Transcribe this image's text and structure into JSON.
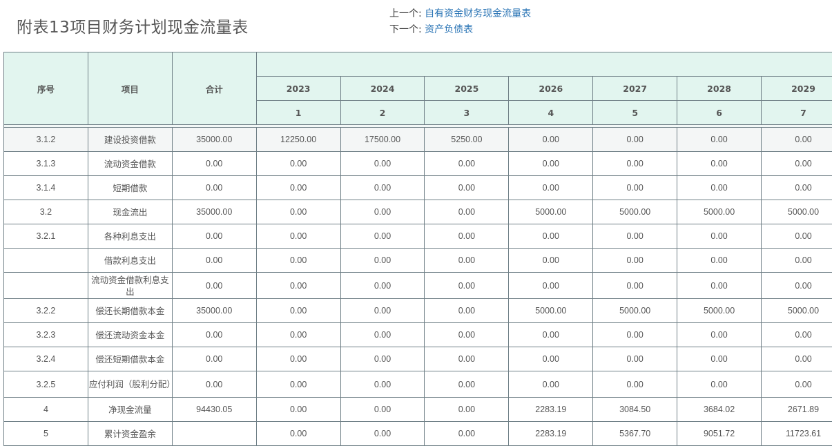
{
  "title": "附表13项目财务计划现金流量表",
  "nav": {
    "prev_label": "上一个:",
    "prev_link": "自有资金财务现金流量表",
    "next_label": "下一个:",
    "next_link": "资产负债表"
  },
  "table": {
    "headers": {
      "seq": "序号",
      "item": "项目",
      "total": "合计"
    },
    "years": [
      "2023",
      "2024",
      "2025",
      "2026",
      "2027",
      "2028",
      "2029"
    ],
    "indices": [
      "1",
      "2",
      "3",
      "4",
      "5",
      "6",
      "7"
    ],
    "rows": [
      {
        "seq": "3.1.2",
        "name": "建设投资借款",
        "total": "35000.00",
        "vals": [
          "12250.00",
          "17500.00",
          "5250.00",
          "0.00",
          "0.00",
          "0.00",
          "0.00"
        ]
      },
      {
        "seq": "3.1.3",
        "name": "流动资金借款",
        "total": "0.00",
        "vals": [
          "0.00",
          "0.00",
          "0.00",
          "0.00",
          "0.00",
          "0.00",
          "0.00"
        ]
      },
      {
        "seq": "3.1.4",
        "name": "短期借款",
        "total": "0.00",
        "vals": [
          "0.00",
          "0.00",
          "0.00",
          "0.00",
          "0.00",
          "0.00",
          "0.00"
        ]
      },
      {
        "seq": "3.2",
        "name": "现金流出",
        "total": "35000.00",
        "vals": [
          "0.00",
          "0.00",
          "0.00",
          "5000.00",
          "5000.00",
          "5000.00",
          "5000.00"
        ]
      },
      {
        "seq": "3.2.1",
        "name": "各种利息支出",
        "total": "0.00",
        "vals": [
          "0.00",
          "0.00",
          "0.00",
          "0.00",
          "0.00",
          "0.00",
          "0.00"
        ]
      },
      {
        "seq": "",
        "name": "借款利息支出",
        "total": "0.00",
        "vals": [
          "0.00",
          "0.00",
          "0.00",
          "0.00",
          "0.00",
          "0.00",
          "0.00"
        ]
      },
      {
        "seq": "",
        "name": "流动资金借款利息支出",
        "total": "0.00",
        "vals": [
          "0.00",
          "0.00",
          "0.00",
          "0.00",
          "0.00",
          "0.00",
          "0.00"
        ]
      },
      {
        "seq": "3.2.2",
        "name": "偿还长期借款本金",
        "total": "35000.00",
        "vals": [
          "0.00",
          "0.00",
          "0.00",
          "5000.00",
          "5000.00",
          "5000.00",
          "5000.00"
        ]
      },
      {
        "seq": "3.2.3",
        "name": "偿还流动资金本金",
        "total": "0.00",
        "vals": [
          "0.00",
          "0.00",
          "0.00",
          "0.00",
          "0.00",
          "0.00",
          "0.00"
        ]
      },
      {
        "seq": "3.2.4",
        "name": "偿还短期借款本金",
        "total": "0.00",
        "vals": [
          "0.00",
          "0.00",
          "0.00",
          "0.00",
          "0.00",
          "0.00",
          "0.00"
        ]
      },
      {
        "seq": "3.2.5",
        "name": "应付利润（股利分配）",
        "total": "0.00",
        "vals": [
          "0.00",
          "0.00",
          "0.00",
          "0.00",
          "0.00",
          "0.00",
          "0.00"
        ]
      },
      {
        "seq": "4",
        "name": "净现金流量",
        "total": "94430.05",
        "vals": [
          "0.00",
          "0.00",
          "0.00",
          "2283.19",
          "3084.50",
          "3684.02",
          "2671.89"
        ]
      },
      {
        "seq": "5",
        "name": "累计资金盈余",
        "total": "",
        "vals": [
          "0.00",
          "0.00",
          "0.00",
          "2283.19",
          "5367.70",
          "9051.72",
          "11723.61"
        ]
      }
    ]
  }
}
